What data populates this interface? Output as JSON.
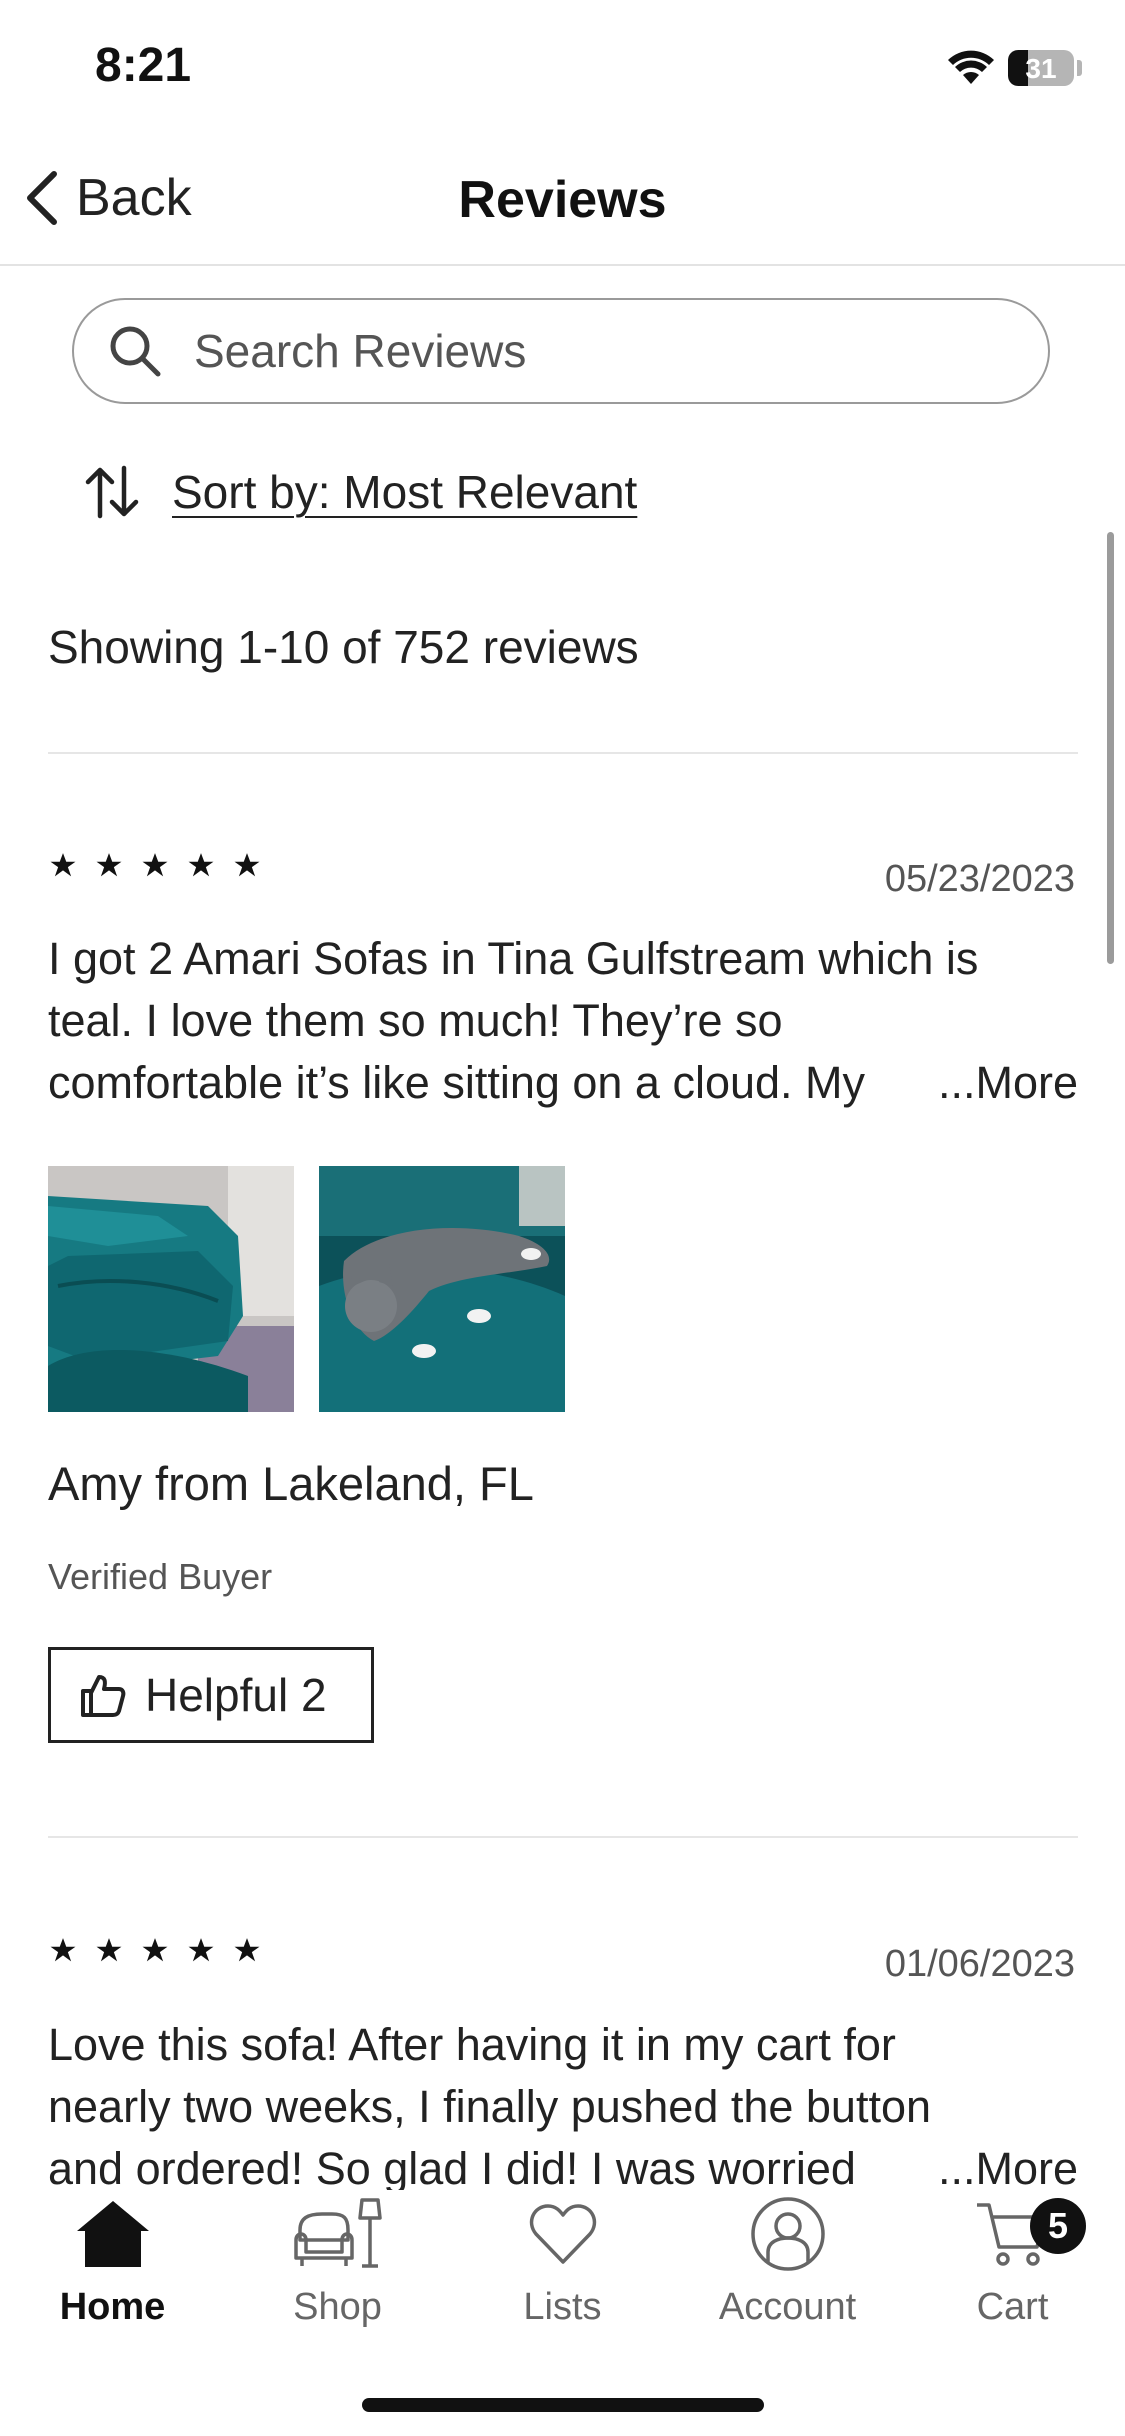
{
  "status_bar": {
    "time": "8:21",
    "battery": "31",
    "battery_level": 0.31
  },
  "nav": {
    "back_label": "Back",
    "title": "Reviews"
  },
  "search": {
    "placeholder": "Search Reviews",
    "value": ""
  },
  "sort": {
    "label": "Sort by: Most Relevant"
  },
  "summary": {
    "showing_text": "Showing 1-10 of 752 reviews"
  },
  "reviews": [
    {
      "rating": 5,
      "date": "05/23/2023",
      "text_lines": [
        "I got 2 Amari Sofas in Tina Gulfstream which is",
        "teal. I love them so much! They’re so",
        "comfortable it’s like sitting on a cloud. My"
      ],
      "more_label": "...More",
      "photos": [
        "teal-sofa-photo",
        "cat-on-sofa-photo"
      ],
      "author": "Amy from Lakeland, FL",
      "verified": "Verified Buyer",
      "helpful_label": "Helpful 2"
    },
    {
      "rating": 5,
      "date": "01/06/2023",
      "text_lines": [
        "Love this sofa! After having it in my cart for",
        "nearly two weeks, I finally pushed the button",
        "and ordered! So glad I did! I was worried"
      ],
      "more_label": "...More"
    }
  ],
  "tab_bar": {
    "tabs": [
      {
        "label": "Home",
        "icon": "home-icon",
        "active": true
      },
      {
        "label": "Shop",
        "icon": "sofa-lamp-icon",
        "active": false
      },
      {
        "label": "Lists",
        "icon": "heart-icon",
        "active": false
      },
      {
        "label": "Account",
        "icon": "account-icon",
        "active": false
      },
      {
        "label": "Cart",
        "icon": "cart-icon",
        "active": false
      }
    ],
    "cart_count": "5"
  },
  "colors": {
    "text": "#1a1a1a",
    "muted": "#555555",
    "border": "#9a9a9a",
    "divider": "#e6e6e6",
    "teal": "#1b7f86"
  }
}
